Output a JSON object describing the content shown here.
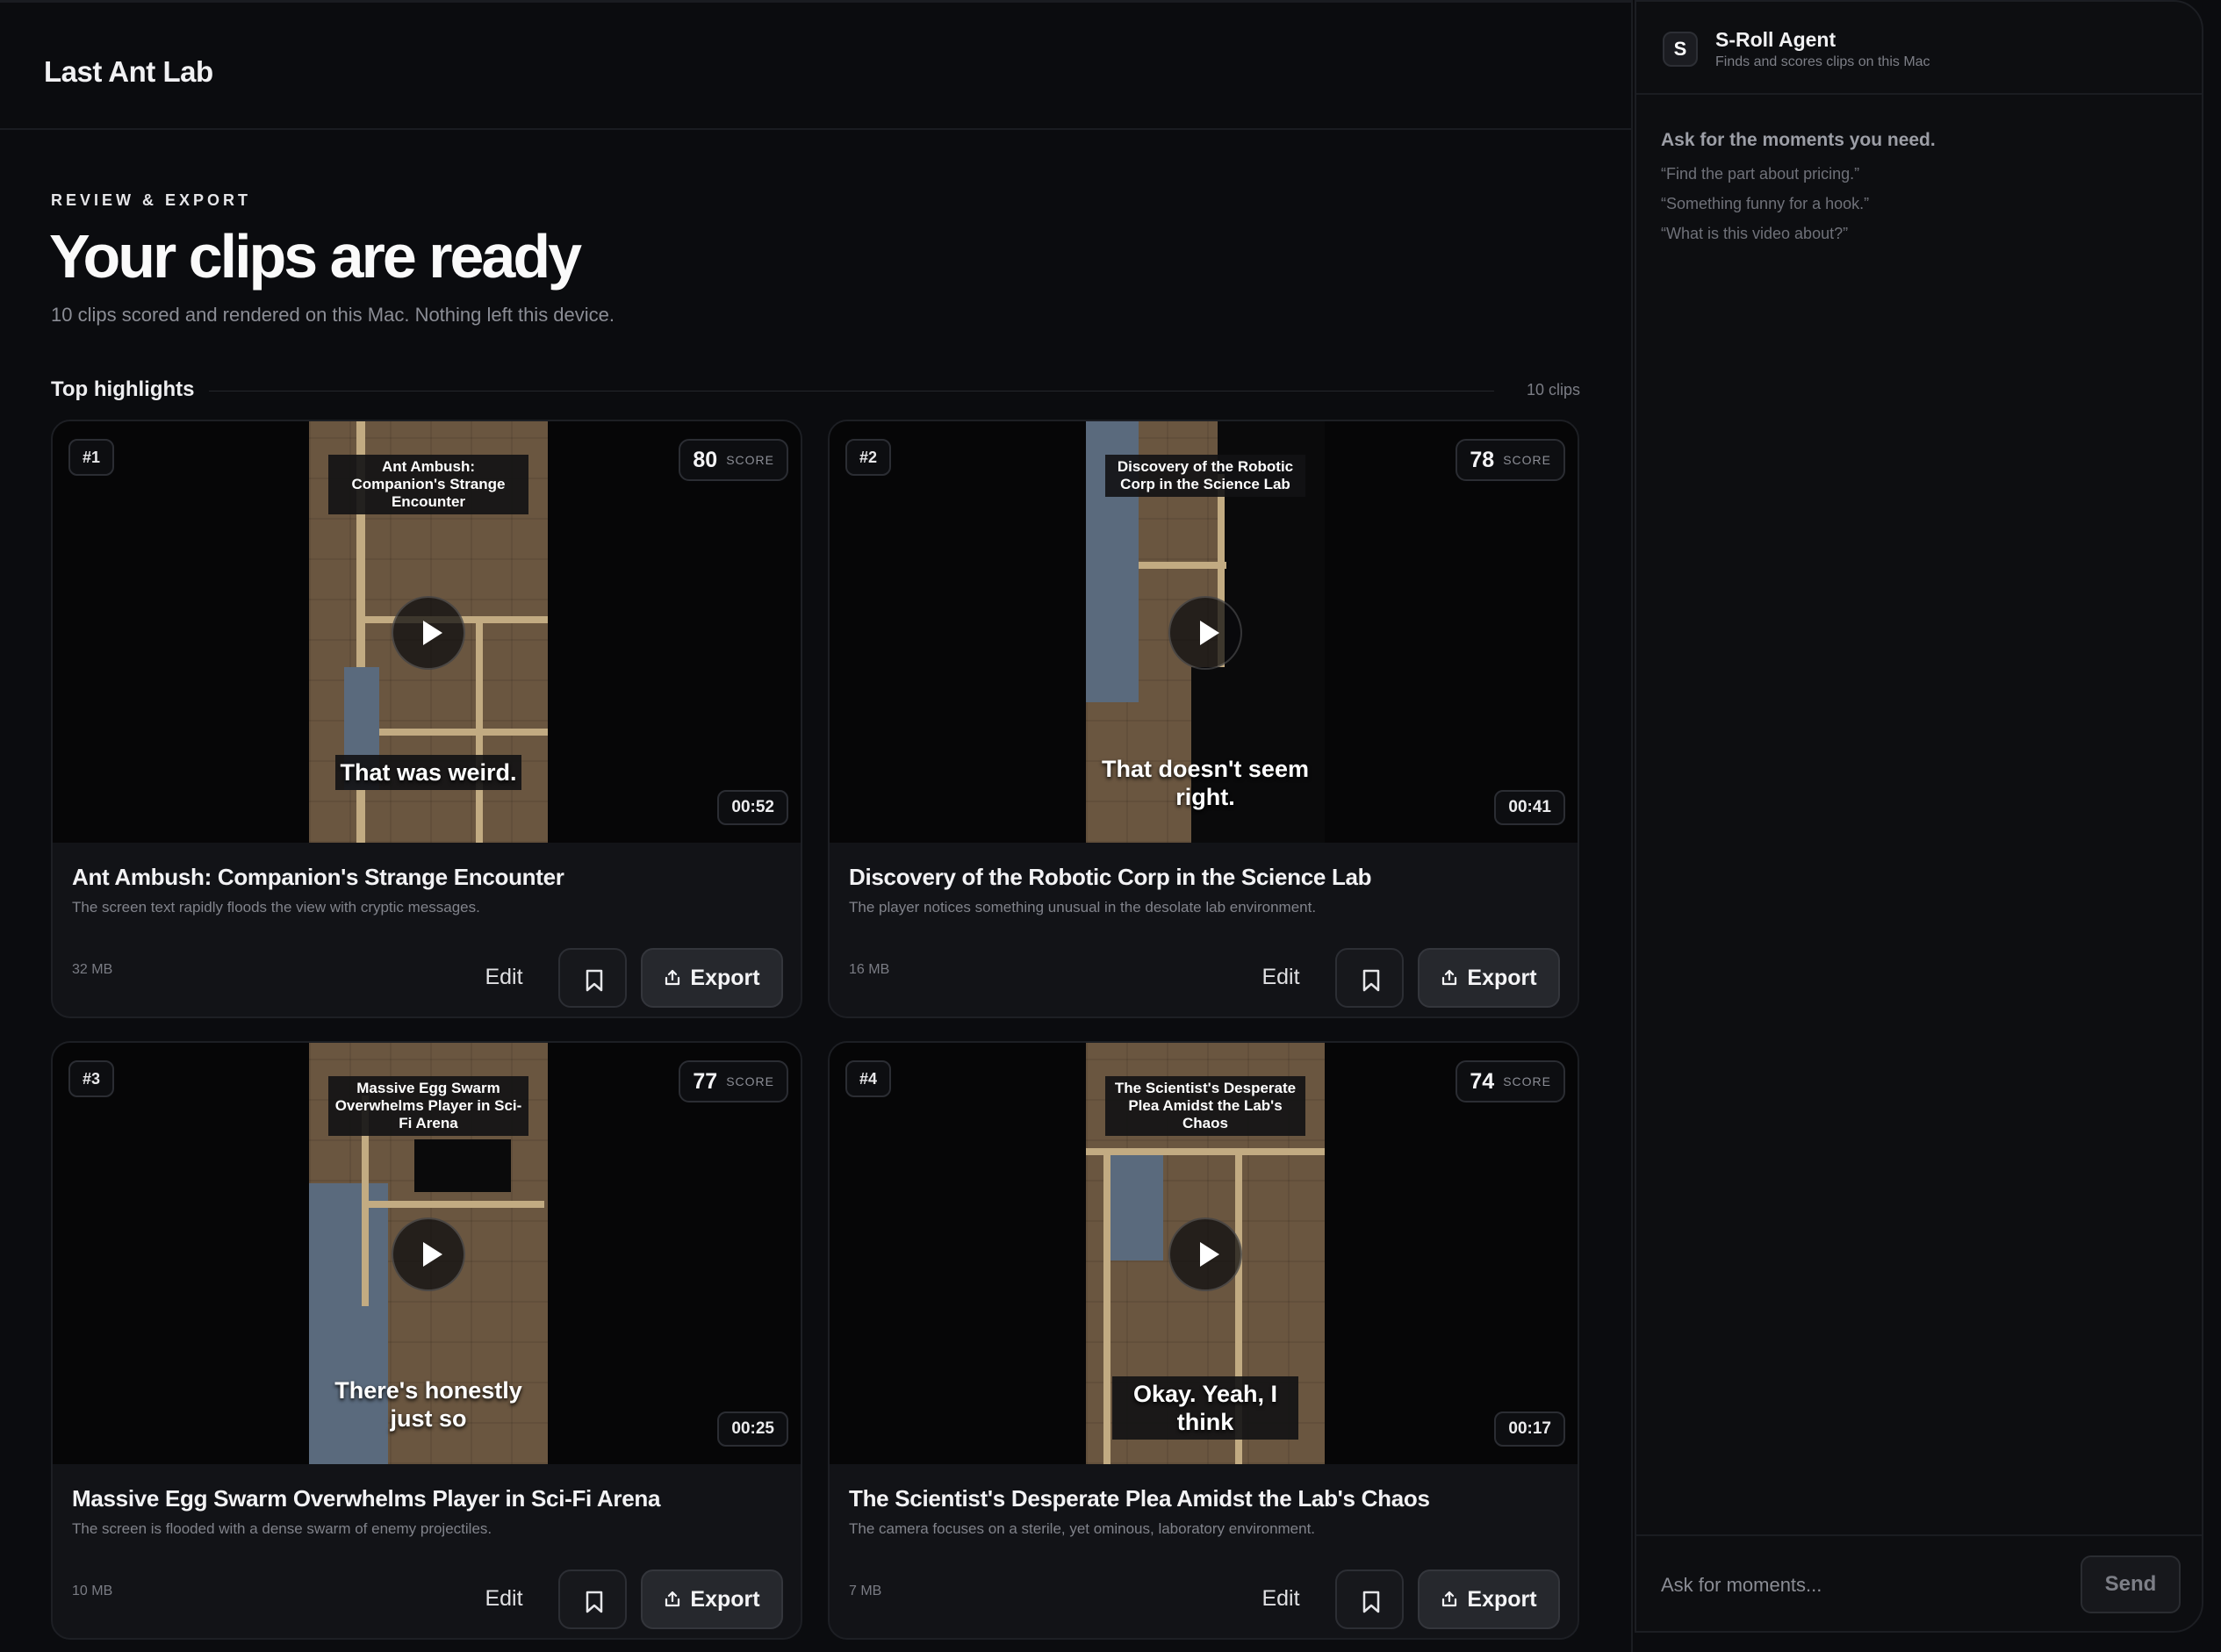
{
  "app": {
    "title": "Last Ant Lab"
  },
  "page": {
    "eyebrow": "REVIEW & EXPORT",
    "headline": "Your clips are ready",
    "subline": "10 clips scored and rendered on this Mac. Nothing left this device."
  },
  "section": {
    "title": "Top highlights",
    "count": "10 clips"
  },
  "clips": [
    {
      "rank": "#1",
      "score": "80",
      "score_label": "SCORE",
      "duration": "00:52",
      "caption_top": "Ant Ambush: Companion's Strange Encounter",
      "caption_bottom": "That was weird.",
      "title": "Ant Ambush: Companion's Strange Encounter",
      "description": "The screen text rapidly floods the view with cryptic messages.",
      "size": "32 MB",
      "edit_label": "Edit",
      "export_label": "Export"
    },
    {
      "rank": "#2",
      "score": "78",
      "score_label": "SCORE",
      "duration": "00:41",
      "caption_top": "Discovery of the Robotic Corp in the Science Lab",
      "caption_bottom": "That doesn't seem right.",
      "title": "Discovery of the Robotic Corp in the Science Lab",
      "description": "The player notices something unusual in the desolate lab environment.",
      "size": "16 MB",
      "edit_label": "Edit",
      "export_label": "Export"
    },
    {
      "rank": "#3",
      "score": "77",
      "score_label": "SCORE",
      "duration": "00:25",
      "caption_top": "Massive Egg Swarm Overwhelms Player in Sci-Fi Arena",
      "caption_bottom": "There's honestly just so",
      "title": "Massive Egg Swarm Overwhelms Player in Sci-Fi Arena",
      "description": "The screen is flooded with a dense swarm of enemy projectiles.",
      "size": "10 MB",
      "edit_label": "Edit",
      "export_label": "Export"
    },
    {
      "rank": "#4",
      "score": "74",
      "score_label": "SCORE",
      "duration": "00:17",
      "caption_top": "The Scientist's Desperate Plea Amidst the Lab's Chaos",
      "caption_bottom": "Okay. Yeah, I think",
      "title": "The Scientist's Desperate Plea Amidst the Lab's Chaos",
      "description": "The camera focuses on a sterile, yet ominous, laboratory environment.",
      "size": "7 MB",
      "edit_label": "Edit",
      "export_label": "Export"
    }
  ],
  "agent": {
    "logo_letter": "S",
    "name": "S-Roll Agent",
    "subtitle": "Finds and scores clips on this Mac",
    "prompt_title": "Ask for the moments you need.",
    "examples": [
      "“Find the part about pricing.”",
      "“Something funny for a hook.”",
      "“What is this video about?”"
    ],
    "input_placeholder": "Ask for moments...",
    "send_label": "Send"
  },
  "icons": {
    "play": "play-icon",
    "bookmark": "bookmark-icon",
    "export": "export-icon",
    "logo": "agent-logo-icon"
  },
  "colors": {
    "background": "#0b0c0f",
    "panel": "#0d0e11",
    "card": "#121317",
    "accent": "#26282d"
  }
}
